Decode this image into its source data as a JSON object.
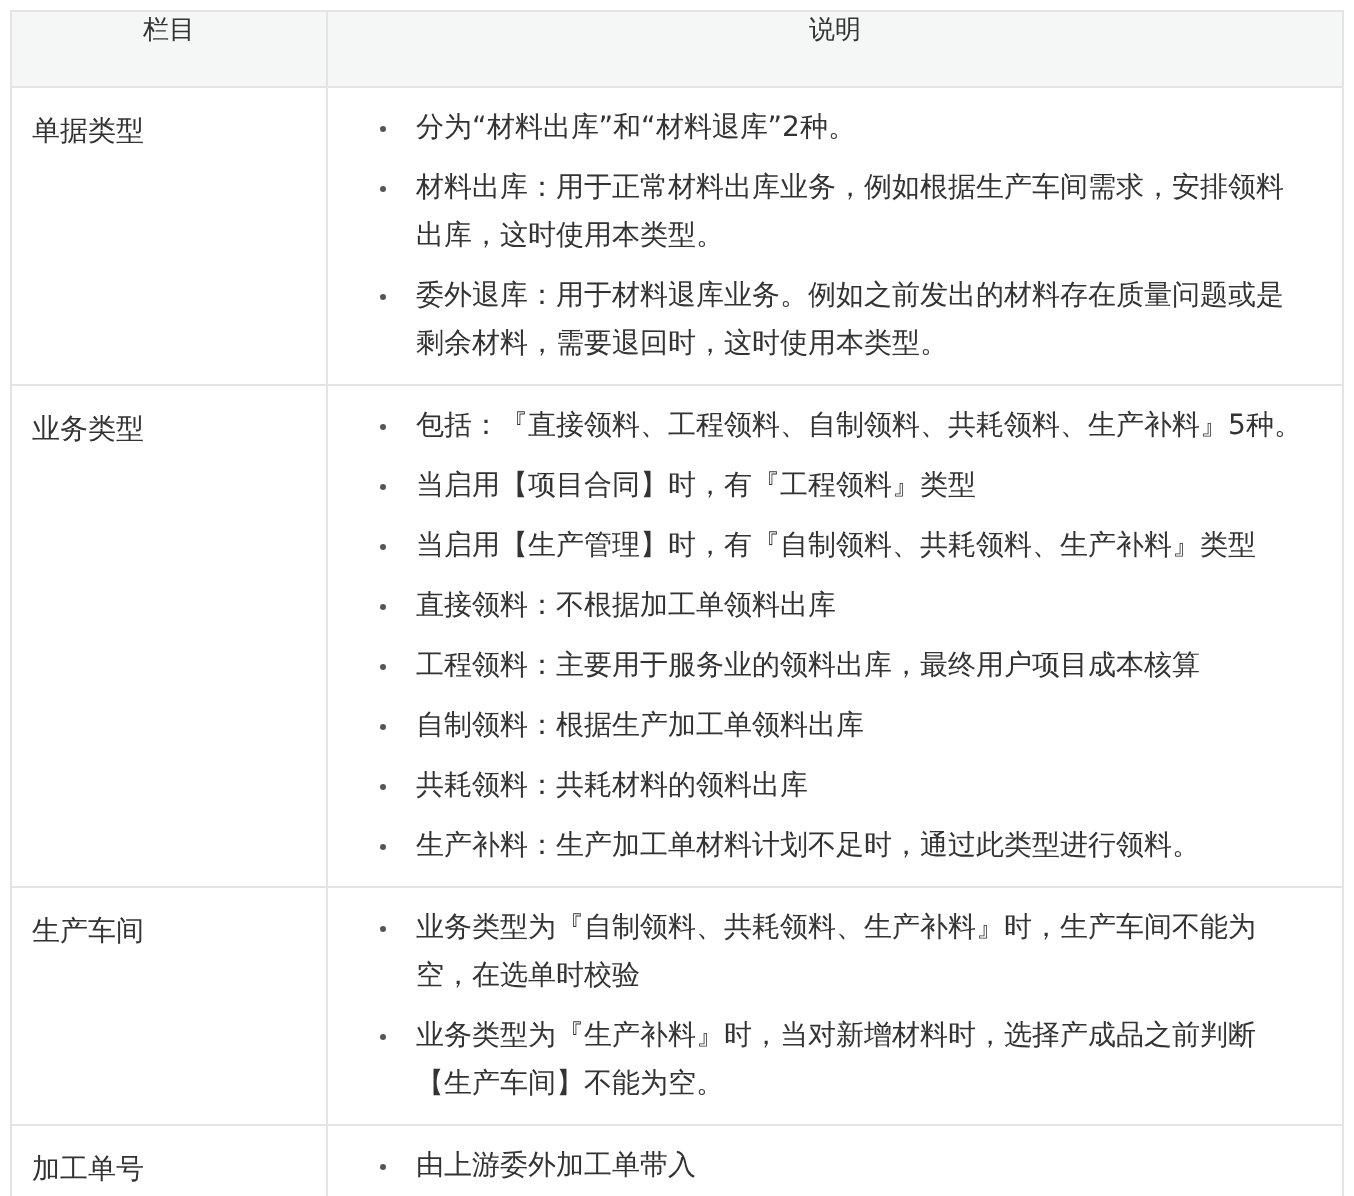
{
  "table": {
    "columns": [
      "栏目",
      "说明"
    ],
    "rows": [
      {
        "field": "单据类型",
        "notes": [
          "分为“材料出库”和“材料退库”2种。",
          "材料出库：用于正常材料出库业务，例如根据生产车间需求，安排领料出库，这时使用本类型。",
          "委外退库：用于材料退库业务。例如之前发出的材料存在质量问题或是剩余材料，需要退回时，这时使用本类型。"
        ]
      },
      {
        "field": "业务类型",
        "notes": [
          "包括：『直接领料、工程领料、自制领料、共耗领料、生产补料』5种。",
          "当启用【项目合同】时，有『工程领料』类型",
          "当启用【生产管理】时，有『自制领料、共耗领料、生产补料』类型",
          "直接领料：不根据加工单领料出库",
          "工程领料：主要用于服务业的领料出库，最终用户项目成本核算",
          "自制领料：根据生产加工单领料出库",
          "共耗领料：共耗材料的领料出库",
          "生产补料：生产加工单材料计划不足时，通过此类型进行领料。"
        ]
      },
      {
        "field": "生产车间",
        "notes": [
          "业务类型为『自制领料、共耗领料、生产补料』时，生产车间不能为空，在选单时校验",
          "业务类型为『生产补料』时，当对新增材料时，选择产成品之前判断【生产车间】不能为空。"
        ]
      },
      {
        "field": "加工单号",
        "notes": [
          "由上游委外加工单带入"
        ]
      }
    ]
  }
}
